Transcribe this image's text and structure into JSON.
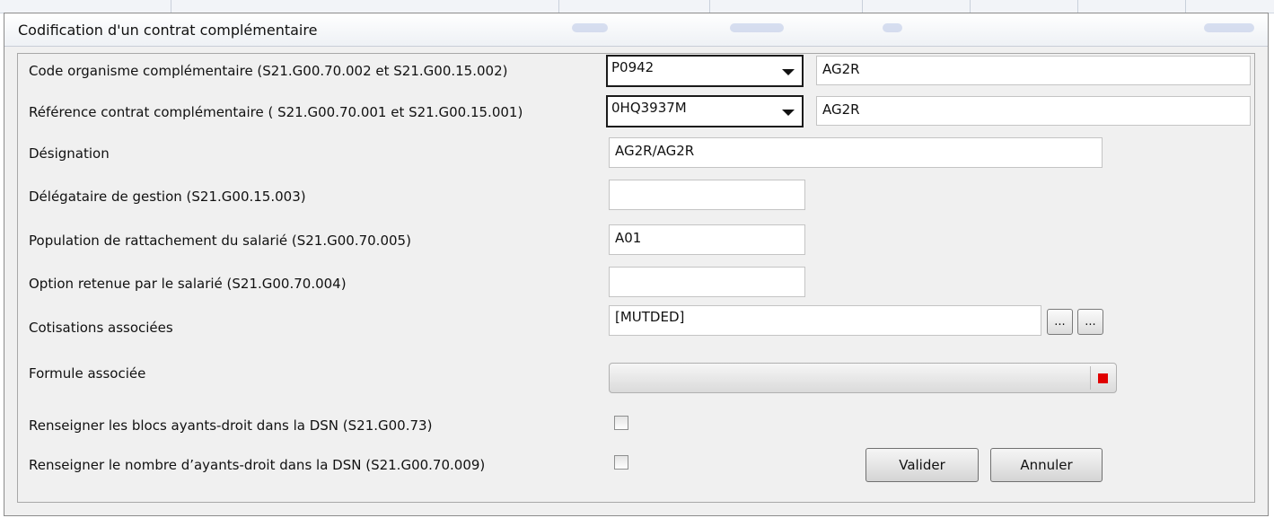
{
  "dialog": {
    "title": "Codification d'un contrat complémentaire"
  },
  "form": {
    "code_organisme": {
      "label": "Code organisme complémentaire (S21.G00.70.002 et S21.G00.15.002)",
      "value": "P0942",
      "name": "AG2R"
    },
    "reference_contrat": {
      "label": "Référence contrat complémentaire ( S21.G00.70.001 et S21.G00.15.001)",
      "value": "0HQ3937M",
      "name": "AG2R"
    },
    "designation": {
      "label": "Désignation",
      "value": "AG2R/AG2R"
    },
    "delegataire": {
      "label": "Délégataire de gestion (S21.G00.15.003)",
      "value": ""
    },
    "population": {
      "label": "Population de rattachement du salarié (S21.G00.70.005)",
      "value": "A01"
    },
    "option": {
      "label": "Option retenue par le salarié (S21.G00.70.004)",
      "value": ""
    },
    "cotisations": {
      "label": "Cotisations associées",
      "value": "[MUTDED]",
      "btn1": "...",
      "btn2": "..."
    },
    "formule": {
      "label": "Formule associée"
    },
    "blocs_ayants_droit": {
      "label": "Renseigner les blocs ayants-droit dans la DSN (S21.G00.73)",
      "checked": false
    },
    "nombre_ayants_droit": {
      "label": "Renseigner le nombre d’ayants-droit dans la DSN (S21.G00.70.009)",
      "checked": false
    }
  },
  "buttons": {
    "valider": "Valider",
    "annuler": "Annuler"
  },
  "colors": {
    "formula_indicator": "#e00000",
    "dialog_bg": "#f0f0f0"
  }
}
